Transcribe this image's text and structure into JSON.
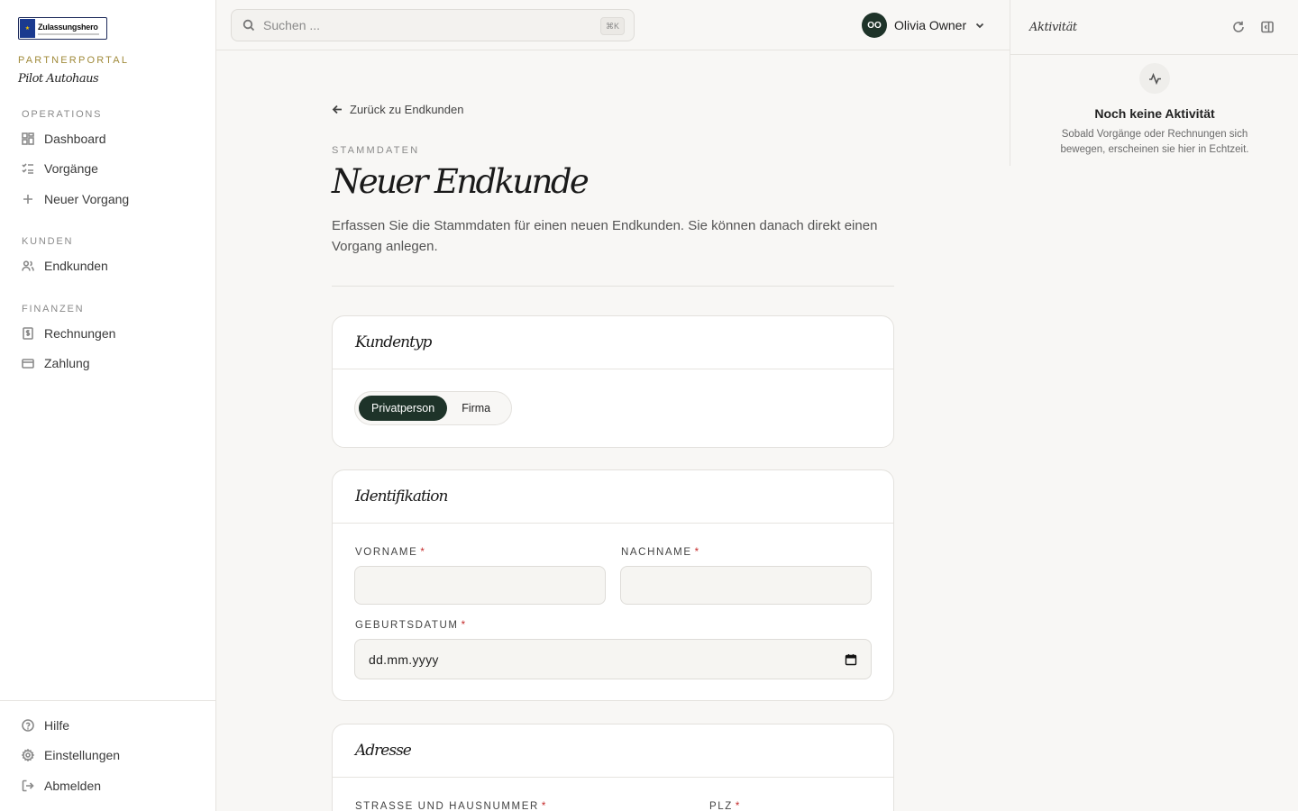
{
  "sidebar": {
    "logo_text": "Zulassungshero",
    "portal_label": "PARTNERPORTAL",
    "portal_name": "Pilot Autohaus",
    "sections": {
      "operations": "OPERATIONS",
      "kunden": "KUNDEN",
      "finanzen": "FINANZEN"
    },
    "items": {
      "dashboard": "Dashboard",
      "vorgaenge": "Vorgänge",
      "neuer_vorgang": "Neuer Vorgang",
      "endkunden": "Endkunden",
      "rechnungen": "Rechnungen",
      "zahlung": "Zahlung"
    },
    "footer": {
      "hilfe": "Hilfe",
      "einstellungen": "Einstellungen",
      "abmelden": "Abmelden"
    }
  },
  "topbar": {
    "search_placeholder": "Suchen ...",
    "search_shortcut": "⌘K",
    "user_initials": "OO",
    "user_name": "Olivia Owner"
  },
  "activity": {
    "title": "Aktivität",
    "empty_title": "Noch keine Aktivität",
    "empty_desc": "Sobald Vorgänge oder Rechnungen sich bewegen, erscheinen sie hier in Echtzeit."
  },
  "main": {
    "back_label": "Zurück zu Endkunden",
    "eyebrow": "STAMMDATEN",
    "title": "Neuer Endkunde",
    "description": "Erfassen Sie die Stammdaten für einen neuen Endkunden. Sie können danach direkt einen Vorgang anlegen.",
    "kundentyp": {
      "title": "Kundentyp",
      "options": [
        "Privatperson",
        "Firma"
      ],
      "selected": "Privatperson"
    },
    "identifikation": {
      "title": "Identifikation",
      "vorname_label": "VORNAME",
      "vorname_value": "",
      "nachname_label": "NACHNAME",
      "nachname_value": "",
      "geburtsdatum_label": "GEBURTSDATUM",
      "geburtsdatum_placeholder": "dd.mm.yyyy"
    },
    "adresse": {
      "title": "Adresse",
      "strasse_label": "STRASSE UND HAUSNUMMER",
      "plz_label": "PLZ"
    },
    "required_marker": "*"
  },
  "colors": {
    "accent_dark_green": "#1e3329",
    "portal_gold": "#a08a3a",
    "required_red": "#c42b2b"
  }
}
